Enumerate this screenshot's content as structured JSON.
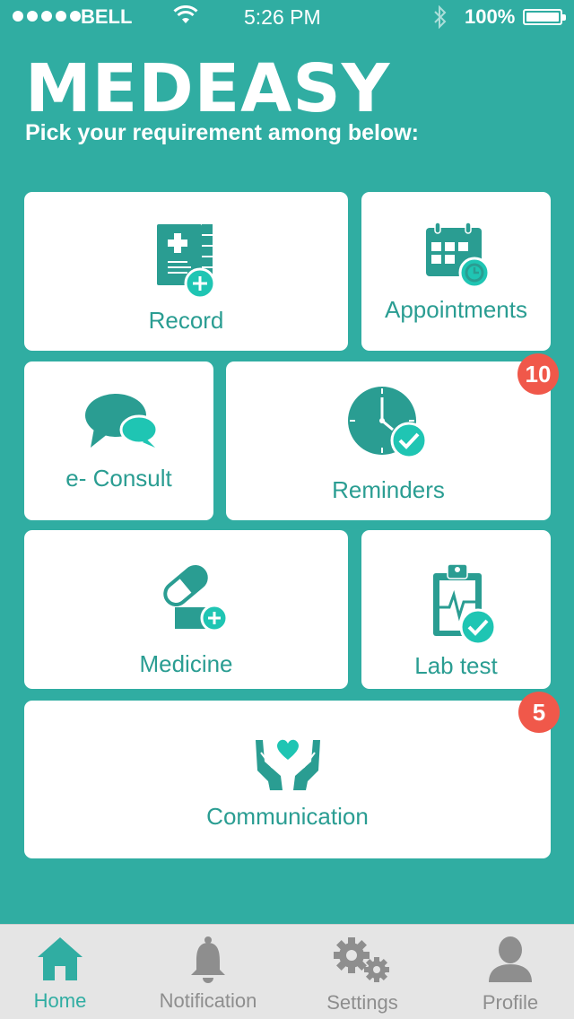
{
  "status_bar": {
    "carrier": "BELL",
    "time": "5:26 PM",
    "battery": "100%",
    "wifi_icon": "wifi-icon",
    "bluetooth_icon": "bluetooth-icon"
  },
  "header": {
    "title": "MEDEASY",
    "subtitle": "Pick your requirement among below:"
  },
  "cards": [
    {
      "id": "record",
      "label": "Record",
      "icon": "medical-record-icon"
    },
    {
      "id": "appointments",
      "label": "Appointments",
      "icon": "calendar-clock-icon"
    },
    {
      "id": "e-consult",
      "label": "e- Consult",
      "icon": "chat-bubbles-icon"
    },
    {
      "id": "reminders",
      "label": "Reminders",
      "icon": "clock-check-icon",
      "badge": "10"
    },
    {
      "id": "medicine",
      "label": "Medicine",
      "icon": "pill-icon"
    },
    {
      "id": "lab-test",
      "label": "Lab test",
      "icon": "clipboard-check-icon"
    },
    {
      "id": "communication",
      "label": "Communication",
      "icon": "hands-heart-icon",
      "badge": "5"
    }
  ],
  "tabs": [
    {
      "label": "Home",
      "icon": "home-icon",
      "active": true
    },
    {
      "label": "Notification",
      "icon": "bell-icon"
    },
    {
      "label": "Settings",
      "icon": "gears-icon"
    },
    {
      "label": "Profile",
      "icon": "user-icon"
    }
  ],
  "colors": {
    "background": "#30ADA2",
    "accent": "#2A9D92",
    "badge": "#F0584A",
    "tabbar": "#E5E5E5"
  }
}
